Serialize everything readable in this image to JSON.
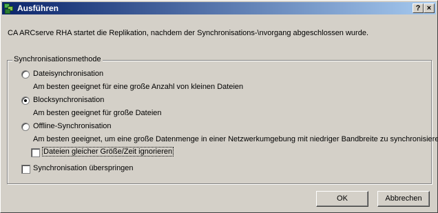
{
  "window": {
    "title": "Ausführen",
    "help_glyph": "?",
    "close_glyph": "×"
  },
  "message": "CA ARCserve RHA startet die Replikation, nachdem der Synchronisations-\\nvorgang abgeschlossen wurde.",
  "sync_group": {
    "legend": "Synchronisationsmethode",
    "options": [
      {
        "label": "Dateisynchronisation",
        "description": "Am besten geeignet für eine große Anzahl von kleinen Dateien",
        "selected": false
      },
      {
        "label": "Blocksynchronisation",
        "description": "Am besten geeignet für große Dateien",
        "selected": true
      },
      {
        "label": "Offline-Synchronisation",
        "description": "Am besten geeignet, um eine große Datenmenge in einer Netzwerkumgebung mit niedriger Bandbreite zu synchronisieren.",
        "selected": false
      }
    ],
    "ignore_same_size": {
      "label": "Dateien gleicher Größe/Zeit ignorieren",
      "checked": false
    },
    "skip_sync": {
      "label": "Synchronisation überspringen",
      "checked": false
    }
  },
  "buttons": {
    "ok_label": "OK",
    "cancel_label": "Abbrechen"
  },
  "icons": {
    "app": "app-icon",
    "help": "help-icon",
    "close": "close-icon"
  }
}
